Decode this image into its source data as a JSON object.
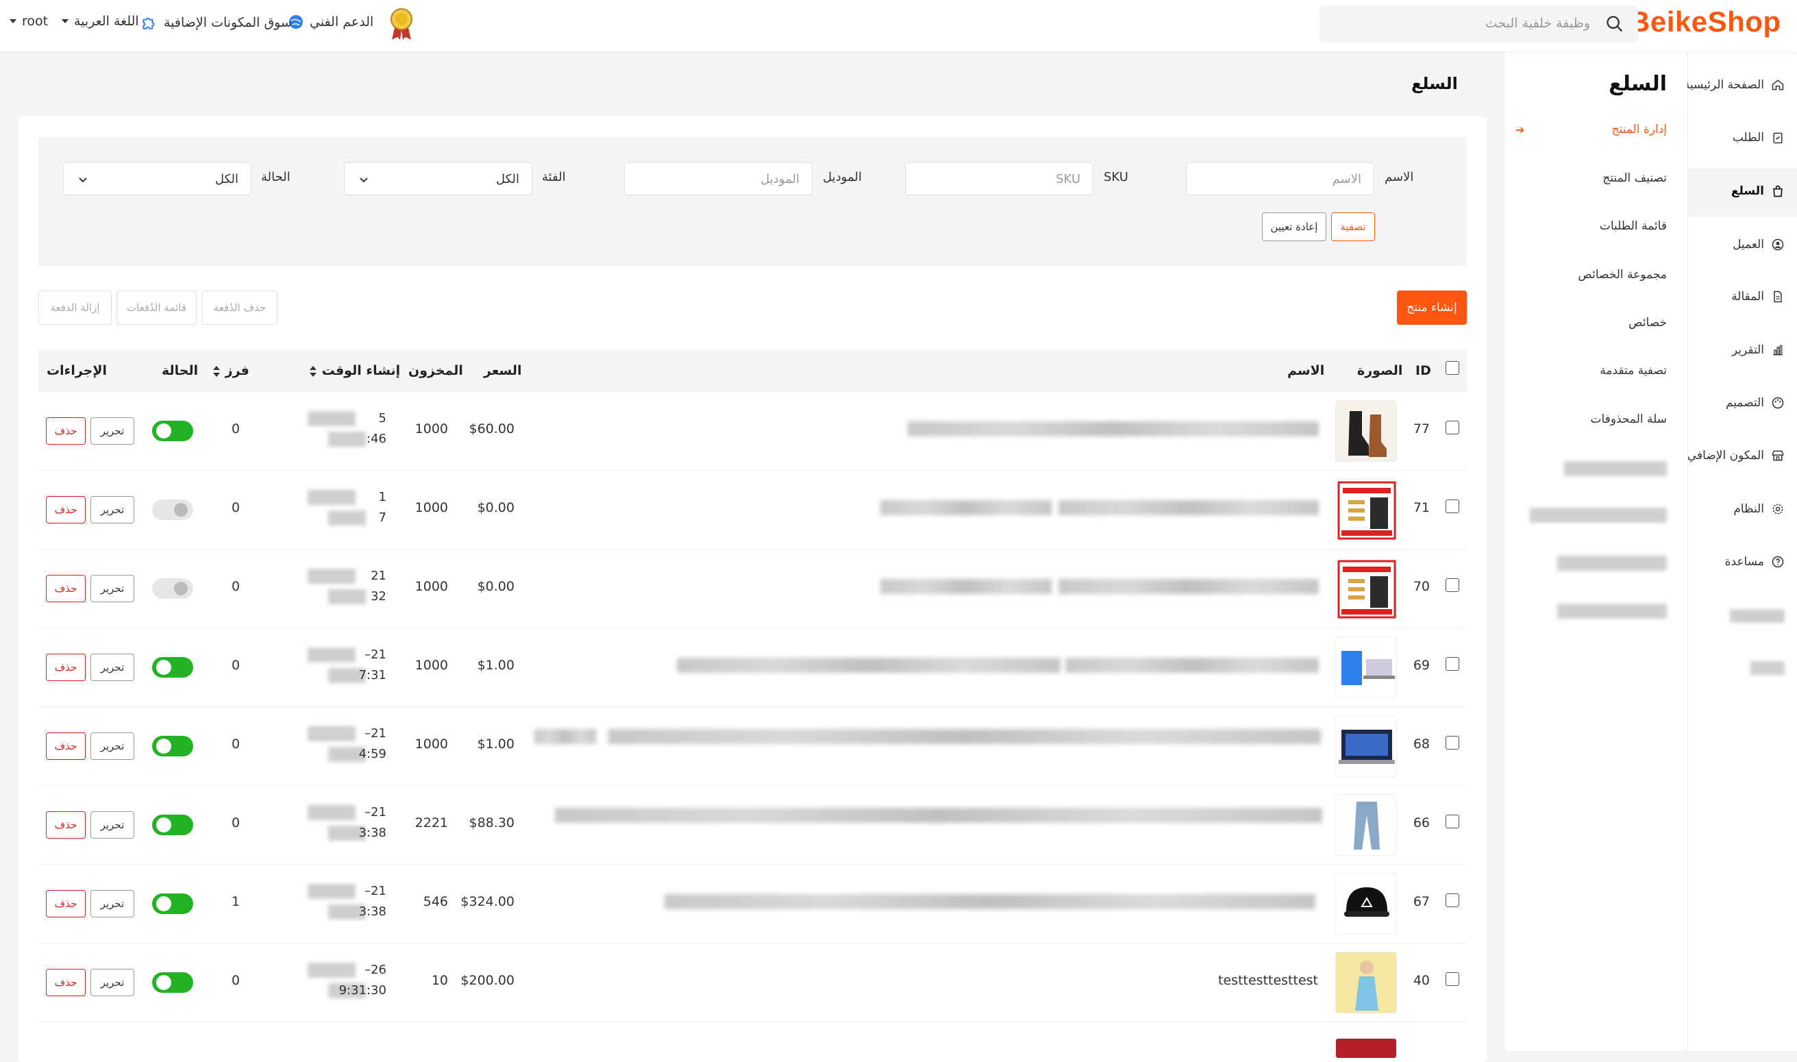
{
  "header": {
    "logo": "BeikeShop",
    "search_placeholder": "وظيفة خلفية البحث",
    "support": "الدعم الفني",
    "market": "سوق المكونات الإضافية",
    "language": "اللغة العربية",
    "user": "root"
  },
  "sidebar": {
    "items": [
      {
        "label": "الصفحة الرئيسية",
        "icon": "home-icon"
      },
      {
        "label": "الطلب",
        "icon": "clipboard-icon"
      },
      {
        "label": "السلع",
        "icon": "bag-icon"
      },
      {
        "label": "العميل",
        "icon": "user-circle-icon"
      },
      {
        "label": "المقالة",
        "icon": "document-icon"
      },
      {
        "label": "التقرير",
        "icon": "bar-chart-icon"
      },
      {
        "label": "التصميم",
        "icon": "palette-icon"
      },
      {
        "label": "المكون الإضافي",
        "icon": "store-icon"
      },
      {
        "label": "النظام",
        "icon": "gear-icon"
      },
      {
        "label": "مساعدة",
        "icon": "question-icon"
      }
    ]
  },
  "subnav": {
    "title": "السلع",
    "items": [
      "إدارة المنتج",
      "تصنيف المنتج",
      "قائمة الطلبات",
      "مجموعة الخصائص",
      "خصائص",
      "تصفية متقدمة",
      "سلة المحذوفات"
    ]
  },
  "page_title": "السلع",
  "filters": {
    "name_label": "الاسم",
    "name_placeholder": "الاسم",
    "sku_label": "SKU",
    "sku_placeholder": "SKU",
    "model_label": "الموديل",
    "model_placeholder": "الموديل",
    "category_label": "الفئة",
    "category_value": "الكل",
    "status_label": "الحالة",
    "status_value": "الكل",
    "filter_button": "تصفية",
    "reset_button": "إعادة تعيين"
  },
  "actions": {
    "create": "إنشاء منتج",
    "batch_delete": "حذف الدُفعة",
    "batch_list": "قائمة الدُفعات",
    "batch_remove": "إزالة الدفعة"
  },
  "table": {
    "headers": {
      "id": "ID",
      "image": "الصورة",
      "name": "الاسم",
      "price": "السعر",
      "stock": "المخزون",
      "created": "إنشاء الوقت",
      "sort": "فرز",
      "status": "الحالة",
      "ops": "الإجراءات"
    },
    "edit_label": "تحرير",
    "delete_label": "حذف",
    "rows": [
      {
        "id": "77",
        "price": "$60.00",
        "stock": "1000",
        "sort": "0",
        "status": true,
        "time1": "5",
        "time2": ":46",
        "thumb": "boots"
      },
      {
        "id": "71",
        "price": "$0.00",
        "stock": "1000",
        "sort": "0",
        "status": false,
        "time1": "1",
        "time2": "7",
        "thumb": "poster"
      },
      {
        "id": "70",
        "price": "$0.00",
        "stock": "1000",
        "sort": "0",
        "status": false,
        "time1": "21",
        "time2": "32",
        "thumb": "poster"
      },
      {
        "id": "69",
        "price": "$1.00",
        "stock": "1000",
        "sort": "0",
        "status": true,
        "time1": "–21",
        "time2": "7:31",
        "thumb": "laptop"
      },
      {
        "id": "68",
        "price": "$1.00",
        "stock": "1000",
        "sort": "0",
        "status": true,
        "time1": "–21",
        "time2": "4:59",
        "thumb": "laptop2"
      },
      {
        "id": "66",
        "price": "$88.30",
        "stock": "2221",
        "sort": "0",
        "status": true,
        "time1": "–21",
        "time2": "3:38",
        "thumb": "jeans"
      },
      {
        "id": "67",
        "price": "$324.00",
        "stock": "546",
        "sort": "1",
        "status": true,
        "time1": "–21",
        "time2": "3:38",
        "thumb": "cap"
      },
      {
        "id": "40",
        "price": "$200.00",
        "stock": "10",
        "sort": "0",
        "status": true,
        "time1": "–26",
        "time2": "9:31:30",
        "thumb": "person",
        "name": "testtesttesttest"
      }
    ]
  },
  "colors": {
    "brand": "#fd560f",
    "toggle_on": "#22b322",
    "delete": "#e02020"
  }
}
